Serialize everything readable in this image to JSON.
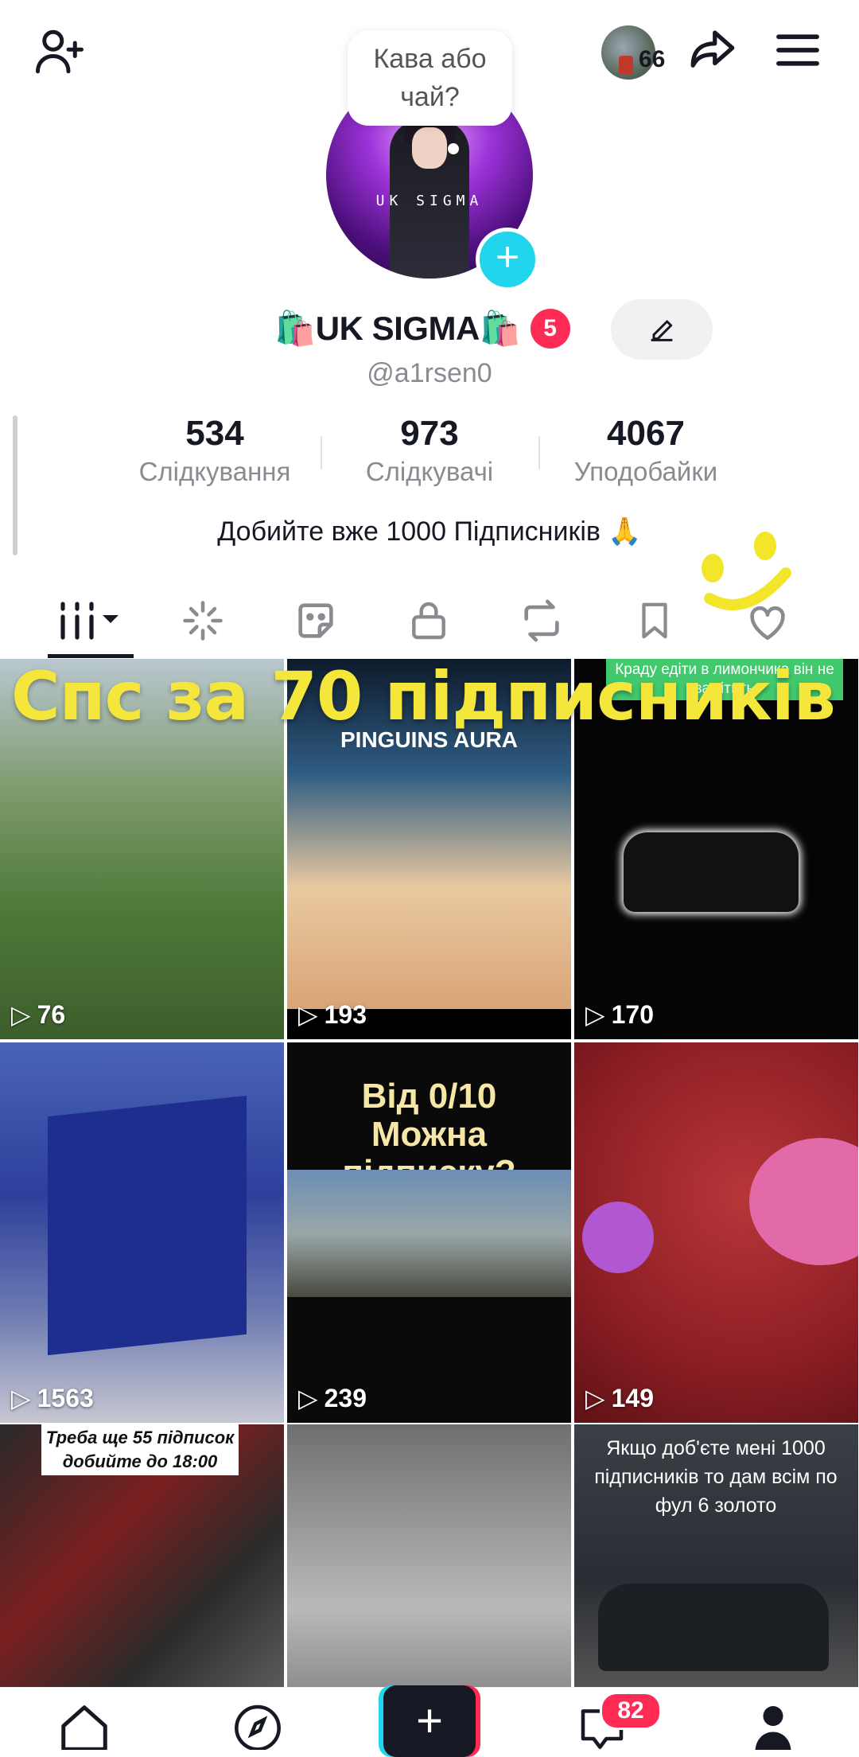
{
  "header": {
    "add_friend_icon": "person-plus-icon",
    "avatar_count": "66",
    "share_icon": "share-icon",
    "menu_icon": "hamburger-icon"
  },
  "profile": {
    "bubble_text": "Кава або\nчай?",
    "name": "🛍️UK SIGMA🛍️",
    "avatar_label": "UK SIGMA",
    "notification_badge": "5",
    "handle": "@a1rsen0",
    "bio": "Добийте вже 1000 Підписників 🙏"
  },
  "stats": [
    {
      "value": "534",
      "label": "Слідкування"
    },
    {
      "value": "973",
      "label": "Слідкувачі"
    },
    {
      "value": "4067",
      "label": "Уподобайки"
    }
  ],
  "tabs": [
    "videos",
    "sparkle",
    "sticker",
    "private",
    "repost",
    "saved",
    "liked"
  ],
  "overlay_text": "Спс за 70 підписників",
  "videos": [
    {
      "views": "76",
      "caption": ""
    },
    {
      "views": "193",
      "caption": "PINGUINS AURA"
    },
    {
      "views": "170",
      "caption": "Краду едіти в лимончика він не замітить"
    },
    {
      "views": "1563",
      "caption": ""
    },
    {
      "views": "239",
      "caption": "Від 0/10\nМожна підписку?"
    },
    {
      "views": "149",
      "caption": ""
    },
    {
      "views": "",
      "caption": "Треба ще 55 підписок добийте до 18:00"
    },
    {
      "views": "",
      "caption": ""
    },
    {
      "views": "",
      "caption": "Якщо доб'єте мені 1000 підписників то дам всім по фул 6 золото"
    }
  ],
  "bottom_nav": {
    "inbox_badge": "82"
  },
  "colors": {
    "accent_red": "#fe2c55",
    "accent_cyan": "#20d5ec",
    "overlay_yellow": "#f5e63c"
  }
}
